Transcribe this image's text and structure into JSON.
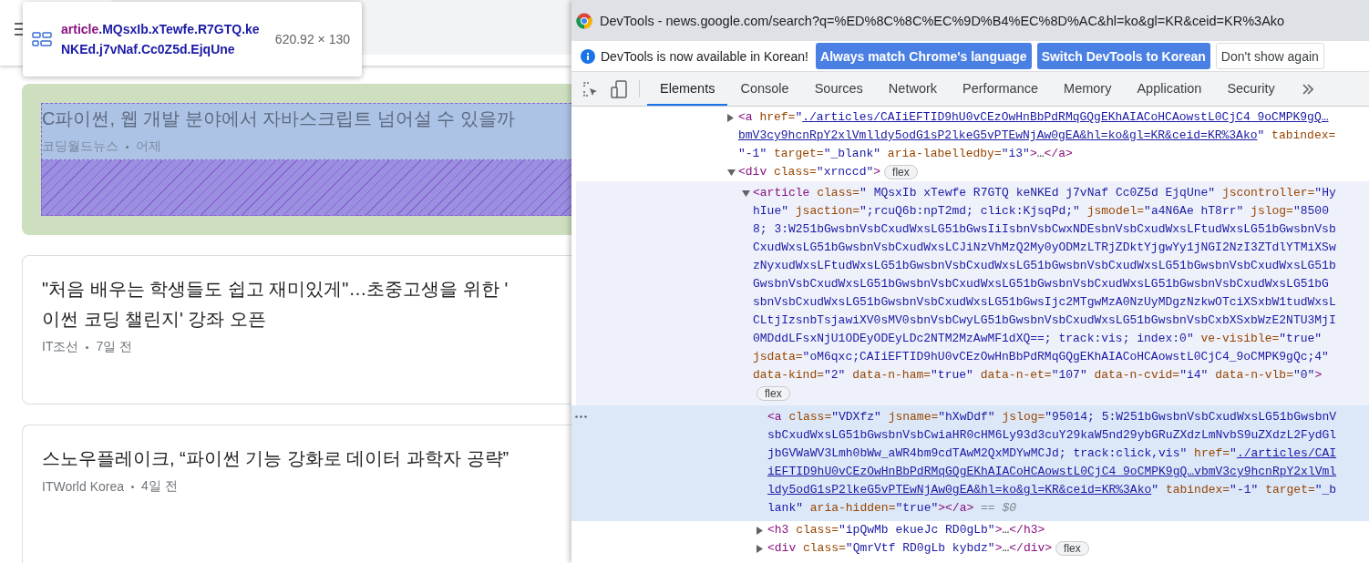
{
  "page": {
    "tooltip": {
      "tag": "article",
      "classes": ".MQsxIb.xTewfe.R7GTQ.keNKEd.j7vNaf.Cc0Z5d.EjqUne",
      "size": "620.92 × 130"
    },
    "articles": [
      {
        "highlighted": true,
        "title_lines": [
          "C파이썬, 웹 개발 분야에서 자바스크립트 넘어설 수 있을까"
        ],
        "source": "코딩월드뉴스",
        "time": "어제"
      },
      {
        "highlighted": false,
        "title_lines": [
          "\"처음 배우는 학생들도 쉽고 재미있게\"…초중고생을 위한 '",
          "이썬 코딩 챌린지' 강좌 오픈"
        ],
        "source": "IT조선",
        "time": "7일 전"
      },
      {
        "highlighted": false,
        "title_lines": [
          "스노우플레이크, “파이썬 기능 강화로 데이터 과학자 공략”"
        ],
        "source": "ITWorld Korea",
        "time": "4일 전"
      }
    ]
  },
  "devtools": {
    "title": "DevTools - news.google.com/search?q=%ED%8C%8C%EC%9D%B4%EC%8D%AC&hl=ko&gl=KR&ceid=KR%3Ako",
    "infobar": {
      "message": "DevTools is now available in Korean!",
      "buttons": [
        {
          "label": "Always match Chrome's language",
          "kind": "primary"
        },
        {
          "label": "Switch DevTools to Korean",
          "kind": "primary"
        },
        {
          "label": "Don't show again",
          "kind": "secondary"
        }
      ]
    },
    "tabs": [
      {
        "label": "Elements",
        "selected": true
      },
      {
        "label": "Console",
        "selected": false
      },
      {
        "label": "Sources",
        "selected": false
      },
      {
        "label": "Network",
        "selected": false
      },
      {
        "label": "Performance",
        "selected": false
      },
      {
        "label": "Memory",
        "selected": false
      },
      {
        "label": "Application",
        "selected": false
      },
      {
        "label": "Security",
        "selected": false
      }
    ],
    "tree": [
      {
        "expanded": false,
        "selected": false,
        "hovered": false,
        "lines": [
          {
            "code": [
              {
                "kind": "tag",
                "text": "<a"
              },
              {
                "kind": "attr",
                "text": " href="
              },
              {
                "kind": "value",
                "text": "\""
              },
              {
                "kind": "link",
                "text": "./articles/CAIiEFTID9hU0vCEzOwHnBbPdRMqGQgEKhAIACoHCAowstL0CjC4_9oCMPK9gQ…"
              }
            ]
          },
          {
            "code": [
              {
                "kind": "link",
                "text": "bmV3cy9hcnRpY2xlVmlldy5odG1sP2lkeG5vPTEwNjAw0gEA&hl=ko&gl=KR&ceid=KR%3Ako"
              },
              {
                "kind": "value",
                "text": "\""
              },
              {
                "kind": "attr",
                "text": " tabindex="
              }
            ]
          },
          {
            "code": [
              {
                "kind": "value",
                "text": "\"-1\""
              },
              {
                "kind": "attr",
                "text": " target="
              },
              {
                "kind": "value",
                "text": "\"_blank\""
              },
              {
                "kind": "attr",
                "text": " aria-labelledby="
              },
              {
                "kind": "value",
                "text": "\"i3\""
              },
              {
                "kind": "tag",
                "text": ">"
              },
              {
                "kind": "text",
                "text": "…"
              },
              {
                "kind": "tag",
                "text": "</a>"
              }
            ]
          }
        ]
      },
      {
        "expanded": true,
        "selected": false,
        "hovered": false,
        "lines": [
          {
            "code": [
              {
                "kind": "tag",
                "text": "<div"
              },
              {
                "kind": "attr",
                "text": " class="
              },
              {
                "kind": "value",
                "text": "\"xrnccd\""
              },
              {
                "kind": "tag",
                "text": ">"
              }
            ],
            "badge": "flex"
          }
        ],
        "children": [
          {
            "expanded": true,
            "selected": false,
            "hovered": true,
            "lines": [
              {
                "code": [
                  {
                    "kind": "tag",
                    "text": "<article"
                  },
                  {
                    "kind": "attr",
                    "text": " class="
                  },
                  {
                    "kind": "value",
                    "text": "\" MQsxIb xTewfe R7GTQ keNKEd j7vNaf Cc0Z5d EjqUne\""
                  },
                  {
                    "kind": "attr",
                    "text": " jscontroller="
                  },
                  {
                    "kind": "value",
                    "text": "\"Hy"
                  }
                ]
              },
              {
                "code": [
                  {
                    "kind": "value",
                    "text": "hIue\""
                  },
                  {
                    "kind": "attr",
                    "text": " jsaction="
                  },
                  {
                    "kind": "value",
                    "text": "\";rcuQ6b:npT2md; click:KjsqPd;\""
                  },
                  {
                    "kind": "attr",
                    "text": " jsmodel="
                  },
                  {
                    "kind": "value",
                    "text": "\"a4N6Ae hT8rr\""
                  },
                  {
                    "kind": "attr",
                    "text": " jslog="
                  },
                  {
                    "kind": "value",
                    "text": "\"8500"
                  }
                ]
              },
              {
                "code": [
                  {
                    "kind": "value",
                    "text": "8; 3:W251bGwsbnVsbCxudWxsLG51bGwsIiIsbnVsbCwxNDEsbnVsbCxudWxsLFtudWxsLG51bGwsbnVsb"
                  }
                ]
              },
              {
                "code": [
                  {
                    "kind": "value",
                    "text": "CxudWxsLG51bGwsbnVsbCxudWxsLCJiNzVhMzQ2My0yODMzLTRjZDktYjgwYy1jNGI2NzI3ZTdlYTMiXSw"
                  }
                ]
              },
              {
                "code": [
                  {
                    "kind": "value",
                    "text": "zNyxudWxsLFtudWxsLG51bGwsbnVsbCxudWxsLG51bGwsbnVsbCxudWxsLG51bGwsbnVsbCxudWxsLG51b"
                  }
                ]
              },
              {
                "code": [
                  {
                    "kind": "value",
                    "text": "GwsbnVsbCxudWxsLG51bGwsbnVsbCxudWxsLG51bGwsbnVsbCxudWxsLG51bGwsbnVsbCxudWxsLG51bG"
                  }
                ]
              },
              {
                "code": [
                  {
                    "kind": "value",
                    "text": "sbnVsbCxudWxsLG51bGwsbnVsbCxudWxsLG51bGwsIjc2MTgwMzA0NzUyMDgzNzkwOTciXSxbW1tudWxsL"
                  }
                ]
              },
              {
                "code": [
                  {
                    "kind": "value",
                    "text": "CLtjIzsnbTsjawiXV0sMV0sbnVsbCwyLG51bGwsbnVsbCxudWxsLG51bGwsbnVsbCxbXSxbWzE2NTU3MjI"
                  }
                ]
              },
              {
                "code": [
                  {
                    "kind": "value",
                    "text": "0MDddLFsxNjU1ODEyODEyLDc2NTM2MzAwMF1dXQ==; track:vis; index:0\""
                  },
                  {
                    "kind": "attr",
                    "text": " ve-visible="
                  },
                  {
                    "kind": "value",
                    "text": "\"true\""
                  }
                ]
              },
              {
                "code": [
                  {
                    "kind": "attr",
                    "text": "jsdata="
                  },
                  {
                    "kind": "value",
                    "text": "\"oM6qxc;CAIiEFTID9hU0vCEzOwHnBbPdRMqGQgEKhAIACoHCAowstL0CjC4_9oCMPK9gQc;4\""
                  }
                ]
              },
              {
                "code": [
                  {
                    "kind": "attr",
                    "text": "data-kind="
                  },
                  {
                    "kind": "value",
                    "text": "\"2\""
                  },
                  {
                    "kind": "attr",
                    "text": " data-n-ham="
                  },
                  {
                    "kind": "value",
                    "text": "\"true\""
                  },
                  {
                    "kind": "attr",
                    "text": " data-n-et="
                  },
                  {
                    "kind": "value",
                    "text": "\"107\""
                  },
                  {
                    "kind": "attr",
                    "text": " data-n-cvid="
                  },
                  {
                    "kind": "value",
                    "text": "\"i4\""
                  },
                  {
                    "kind": "attr",
                    "text": " data-n-vlb="
                  },
                  {
                    "kind": "value",
                    "text": "\"0\""
                  },
                  {
                    "kind": "tag",
                    "text": ">"
                  }
                ]
              },
              {
                "badge": "flex"
              }
            ],
            "children": [
              {
                "selected": true,
                "hovered": false,
                "lines": [
                  {
                    "code": [
                      {
                        "kind": "tag",
                        "text": "<a"
                      },
                      {
                        "kind": "attr",
                        "text": " class="
                      },
                      {
                        "kind": "value",
                        "text": "\"VDXfz\""
                      },
                      {
                        "kind": "attr",
                        "text": " jsname="
                      },
                      {
                        "kind": "value",
                        "text": "\"hXwDdf\""
                      },
                      {
                        "kind": "attr",
                        "text": " jslog="
                      },
                      {
                        "kind": "value",
                        "text": "\"95014; 5:W251bGwsbnVsbCxudWxsLG51bGwsbnV"
                      }
                    ]
                  },
                  {
                    "code": [
                      {
                        "kind": "value",
                        "text": "sbCxudWxsLG51bGwsbnVsbCwiaHR0cHM6Ly93d3cuY29kaW5nd29ybGRuZXdzLmNvbS9uZXdzL2FydGl"
                      }
                    ]
                  },
                  {
                    "code": [
                      {
                        "kind": "value",
                        "text": "jbGVWaWV3Lmh0bWw_aWR4bm9cdTAwM2QxMDYwMCJd; track:click,vis\""
                      },
                      {
                        "kind": "attr",
                        "text": " href="
                      },
                      {
                        "kind": "value",
                        "text": "\""
                      },
                      {
                        "kind": "link",
                        "text": "./articles/CAI"
                      }
                    ]
                  },
                  {
                    "code": [
                      {
                        "kind": "link",
                        "text": "iEFTID9hU0vCEzOwHnBbPdRMqGQgEKhAIACoHCAowstL0CjC4_9oCMPK9gQ…vbmV3cy9hcnRpY2xlVml"
                      }
                    ]
                  },
                  {
                    "code": [
                      {
                        "kind": "link",
                        "text": "ldy5odG1sP2lkeG5vPTEwNjAw0gEA&hl=ko&gl=KR&ceid=KR%3Ako"
                      },
                      {
                        "kind": "value",
                        "text": "\""
                      },
                      {
                        "kind": "attr",
                        "text": " tabindex="
                      },
                      {
                        "kind": "value",
                        "text": "\"-1\""
                      },
                      {
                        "kind": "attr",
                        "text": " target="
                      },
                      {
                        "kind": "value",
                        "text": "\"_b"
                      }
                    ]
                  },
                  {
                    "code": [
                      {
                        "kind": "value",
                        "text": "lank\""
                      },
                      {
                        "kind": "attr",
                        "text": " aria-hidden="
                      },
                      {
                        "kind": "value",
                        "text": "\"true\""
                      },
                      {
                        "kind": "tag",
                        "text": "></a>"
                      },
                      {
                        "kind": "note",
                        "text": " == $0"
                      }
                    ]
                  }
                ]
              },
              {
                "expanded": false,
                "selected": false,
                "hovered": false,
                "lines": [
                  {
                    "code": [
                      {
                        "kind": "tag",
                        "text": "<h3"
                      },
                      {
                        "kind": "attr",
                        "text": " class="
                      },
                      {
                        "kind": "value",
                        "text": "\"ipQwMb ekueJc RD0gLb\""
                      },
                      {
                        "kind": "tag",
                        "text": ">"
                      },
                      {
                        "kind": "text",
                        "text": "…"
                      },
                      {
                        "kind": "tag",
                        "text": "</h3>"
                      }
                    ]
                  }
                ]
              },
              {
                "expanded": false,
                "selected": false,
                "hovered": false,
                "lines": [
                  {
                    "code": [
                      {
                        "kind": "tag",
                        "text": "<div"
                      },
                      {
                        "kind": "attr",
                        "text": " class="
                      },
                      {
                        "kind": "value",
                        "text": "\"QmrVtf RD0gLb kybdz\""
                      },
                      {
                        "kind": "tag",
                        "text": ">"
                      },
                      {
                        "kind": "text",
                        "text": "…"
                      },
                      {
                        "kind": "tag",
                        "text": "</div>"
                      }
                    ],
                    "badge": "flex"
                  }
                ]
              }
            ]
          }
        ]
      }
    ]
  }
}
